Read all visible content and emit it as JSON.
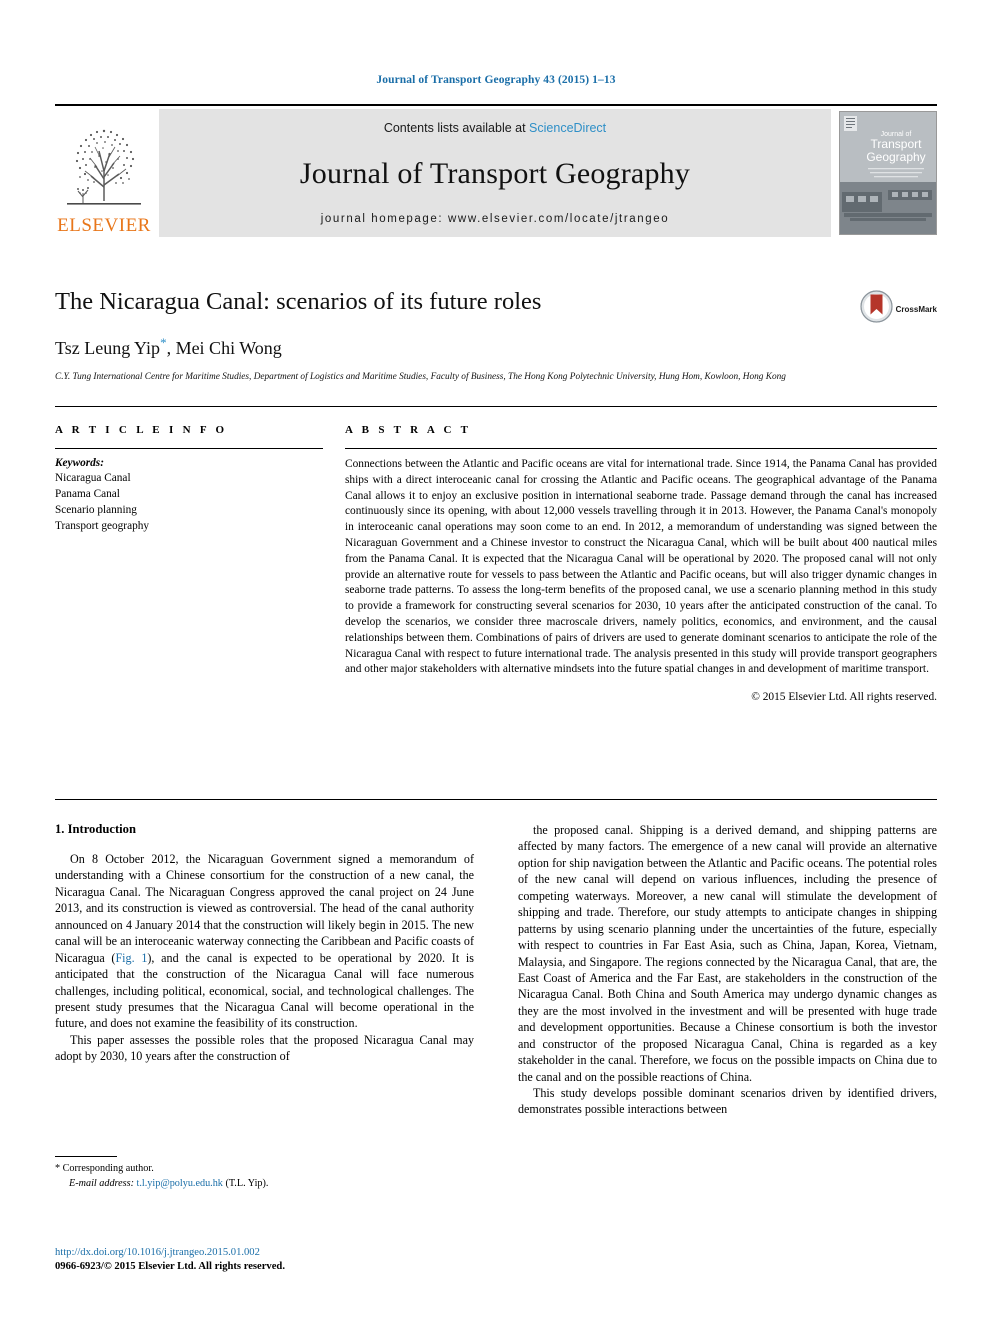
{
  "running_head": "Journal of Transport Geography 43 (2015) 1–13",
  "masthead": {
    "publisher_name": "ELSEVIER",
    "publisher_logo_name": "elsevier-tree-logo",
    "contents_prefix": "Contents lists available at ",
    "contents_link": "ScienceDirect",
    "journal_title": "Journal of Transport Geography",
    "homepage": "journal homepage: www.elsevier.com/locate/jtrangeo",
    "cover_title_line1": "Journal of",
    "cover_title_line2": "Transport",
    "cover_title_line3": "Geography"
  },
  "article": {
    "title": "The Nicaragua Canal: scenarios of its future roles",
    "authors": "Tsz Leung Yip",
    "authors_star": "*",
    "authors_rest": ", Mei Chi Wong",
    "affiliation": "C.Y. Tung International Centre for Maritime Studies, Department of Logistics and Maritime Studies, Faculty of Business, The Hong Kong Polytechnic University, Hung Hom, Kowloon, Hong Kong",
    "crossmark_label": "CrossMark"
  },
  "article_info": {
    "heading": "A R T I C L E   I N F O",
    "keywords_label": "Keywords:",
    "keywords": [
      "Nicaragua Canal",
      "Panama Canal",
      "Scenario planning",
      "Transport geography"
    ]
  },
  "abstract": {
    "heading": "A B S T R A C T",
    "text": "Connections between the Atlantic and Pacific oceans are vital for international trade. Since 1914, the Panama Canal has provided ships with a direct interoceanic canal for crossing the Atlantic and Pacific oceans. The geographical advantage of the Panama Canal allows it to enjoy an exclusive position in international seaborne trade. Passage demand through the canal has increased continuously since its opening, with about 12,000 vessels travelling through it in 2013. However, the Panama Canal's monopoly in interoceanic canal operations may soon come to an end. In 2012, a memorandum of understanding was signed between the Nicaraguan Government and a Chinese investor to construct the Nicaragua Canal, which will be built about 400 nautical miles from the Panama Canal. It is expected that the Nicaragua Canal will be operational by 2020. The proposed canal will not only provide an alternative route for vessels to pass between the Atlantic and Pacific oceans, but will also trigger dynamic changes in seaborne trade patterns. To assess the long-term benefits of the proposed canal, we use a scenario planning method in this study to provide a framework for constructing several scenarios for 2030, 10 years after the anticipated construction of the canal. To develop the scenarios, we consider three macroscale drivers, namely politics, economics, and environment, and the causal relationships between them. Combinations of pairs of drivers are used to generate dominant scenarios to anticipate the role of the Nicaragua Canal with respect to future international trade. The analysis presented in this study will provide transport geographers and other major stakeholders with alternative mindsets into the future spatial changes in and development of maritime transport.",
    "copyright": "© 2015 Elsevier Ltd. All rights reserved."
  },
  "body": {
    "section_heading": "1. Introduction",
    "left_p1_a": "On 8 October 2012, the Nicaraguan Government signed a memorandum of understanding with a Chinese consortium for the construction of a new canal, the Nicaragua Canal. The Nicaraguan Congress approved the canal project on 24 June 2013, and its construction is viewed as controversial. The head of the canal authority announced on 4 January 2014 that the construction will likely begin in 2015. The new canal will be an interoceanic waterway connecting the Caribbean and Pacific coasts of Nicaragua (",
    "left_p1_link": "Fig. 1",
    "left_p1_b": "), and the canal is expected to be operational by 2020. It is anticipated that the construction of the Nicaragua Canal will face numerous challenges, including political, economical, social, and technological challenges. The present study presumes that the Nicaragua Canal will become operational in the future, and does not examine the feasibility of its construction.",
    "left_p2": "This paper assesses the possible roles that the proposed Nicaragua Canal may adopt by 2030, 10 years after the construction of",
    "right_p1": "the proposed canal. Shipping is a derived demand, and shipping patterns are affected by many factors. The emergence of a new canal will provide an alternative option for ship navigation between the Atlantic and Pacific oceans. The potential roles of the new canal will depend on various influences, including the presence of competing waterways. Moreover, a new canal will stimulate the development of shipping and trade. Therefore, our study attempts to anticipate changes in shipping patterns by using scenario planning under the uncertainties of the future, especially with respect to countries in Far East Asia, such as China, Japan, Korea, Vietnam, Malaysia, and Singapore. The regions connected by the Nicaragua Canal, that are, the East Coast of America and the Far East, are stakeholders in the construction of the Nicaragua Canal. Both China and South America may undergo dynamic changes as they are the most involved in the investment and will be presented with huge trade and development opportunities. Because a Chinese consortium is both the investor and constructor of the proposed Nicaragua Canal, China is regarded as a key stakeholder in the canal. Therefore, we focus on the possible impacts on China due to the canal and on the possible reactions of China.",
    "right_p2": "This study develops possible dominant scenarios driven by identified drivers, demonstrates possible interactions between"
  },
  "footnote": {
    "star": "*",
    "corresponding": "Corresponding author.",
    "email_label": "E-mail address:",
    "email": "t.l.yip@polyu.edu.hk",
    "email_suffix": "(T.L. Yip)."
  },
  "footer": {
    "doi": "http://dx.doi.org/10.1016/j.jtrangeo.2015.01.002",
    "issn": "0966-6923/© 2015 Elsevier Ltd. All rights reserved."
  },
  "colors": {
    "link_blue": "#1a6ea8",
    "sciencedirect_blue": "#2e8fc7",
    "elsevier_orange": "#e8761a",
    "band_gray": "#e3e3e3"
  }
}
